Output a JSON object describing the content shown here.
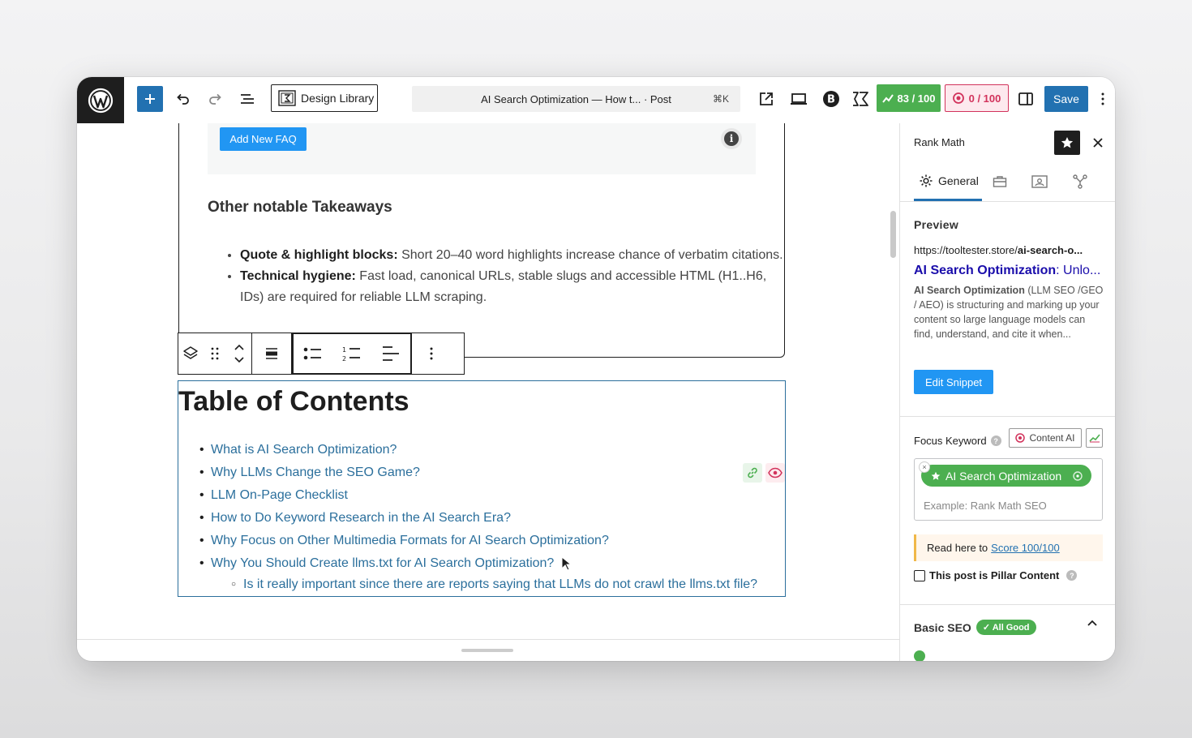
{
  "topbar": {
    "design_library_label": "Design Library",
    "command_bar_title": "AI Search Optimization — How t...  · Post",
    "command_shortcut": "⌘K",
    "seo_score": "83 / 100",
    "content_ai_score": "0 / 100",
    "save_label": "Save"
  },
  "canvas": {
    "faq_button_label": "Add New FAQ",
    "takeaways_heading": "Other notable Takeaways",
    "takeaways": [
      {
        "bold": "Quote & highlight blocks:",
        "text": " Short 20–40 word highlights increase chance of verbatim citations."
      },
      {
        "bold": "Technical hygiene:",
        "text": " Fast load, canonical URLs, stable slugs and accessible HTML (H1..H6, IDs) are required for reliable LLM scraping."
      }
    ],
    "toc_title": "Table of Contents",
    "toc_items": [
      "What is AI Search Optimization?",
      "Why LLMs Change the SEO Game?",
      "LLM On-Page Checklist",
      "How to Do Keyword Research in the AI Search Era?",
      "Why Focus on Other Multimedia Formats for AI Search Optimization?",
      "Why You Should Create llms.txt for AI Search Optimization?"
    ],
    "toc_subitem": "Is it really important since there are reports saying that LLMs do not crawl the llms.txt file?"
  },
  "sidebar": {
    "title": "Rank Math",
    "tab_general": "General",
    "preview_heading": "Preview",
    "preview_url": "https://tooltester.store/ai-search-o...",
    "preview_url_plain": "https://tooltester.store/",
    "preview_url_bold": "ai-search-o...",
    "preview_title_bold": "AI Search Optimization",
    "preview_title_rest": ": Unlo...",
    "preview_desc_bold": "AI Search Optimization",
    "preview_desc_rest": " (LLM SEO /GEO / AEO) is structuring and marking up your content so large language models can find, understand, and cite it when...",
    "edit_snippet_label": "Edit Snippet",
    "focus_keyword_label": "Focus Keyword",
    "content_ai_label": "Content AI",
    "focus_keyword": "AI Search Optimization",
    "keyword_placeholder": "Example: Rank Math SEO",
    "notice_text": "Read here to",
    "notice_link": "Score 100/100",
    "pillar_label": "This post is Pillar Content",
    "basic_seo_label": "Basic SEO",
    "basic_seo_badge": "✓ All Good"
  },
  "colors": {
    "accent": "#2271b1",
    "faq_button": "#2196f3",
    "score_good": "#4caf50",
    "score_bad": "#d2335c",
    "toc_link": "#2b6f9c",
    "preview_title": "#1a0dab"
  }
}
